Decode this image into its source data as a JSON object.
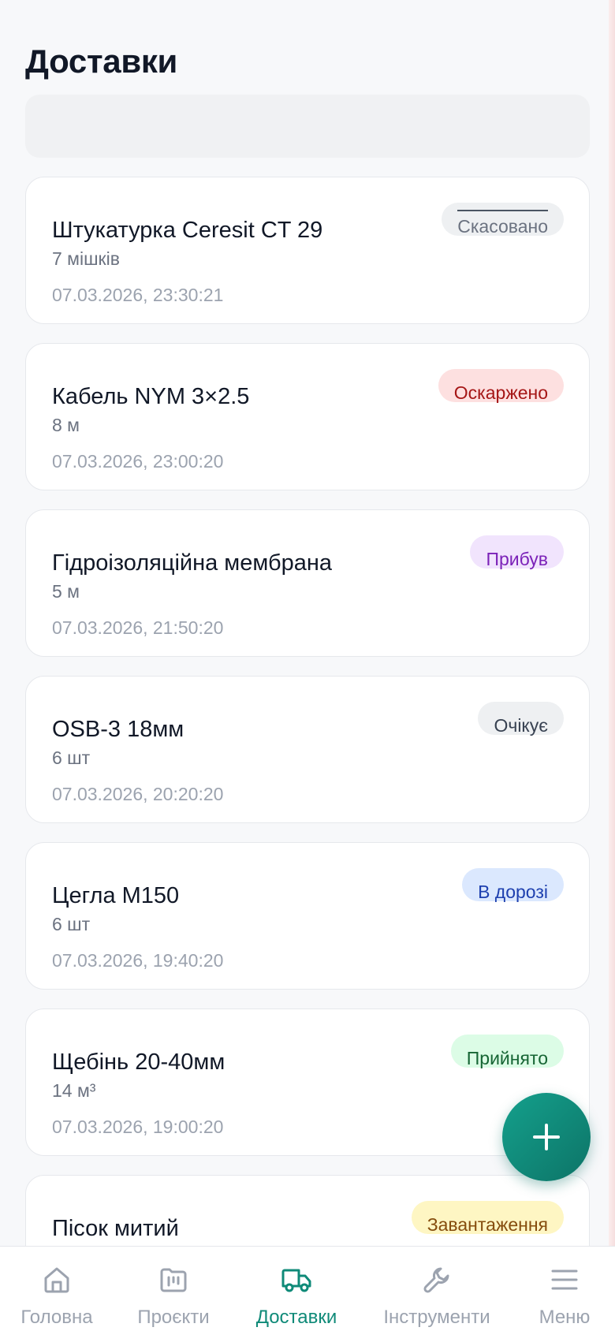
{
  "header": {
    "title": "Доставки"
  },
  "search": {
    "placeholder": ""
  },
  "deliveries": [
    {
      "name": "Штукатурка Ceresit CT 29",
      "quantity": "7 мішків",
      "datetime": "07.03.2026, 23:30:21",
      "status": "Скасовано",
      "status_kind": "cancelled"
    },
    {
      "name": "Кабель NYM 3×2.5",
      "quantity": "8 м",
      "datetime": "07.03.2026, 23:00:20",
      "status": "Оскаржено",
      "status_kind": "disputed"
    },
    {
      "name": "Гідроізоляційна мембрана",
      "quantity": "5 м",
      "datetime": "07.03.2026, 21:50:20",
      "status": "Прибув",
      "status_kind": "arrived"
    },
    {
      "name": "OSB-3 18мм",
      "quantity": "6 шт",
      "datetime": "07.03.2026, 20:20:20",
      "status": "Очікує",
      "status_kind": "waiting"
    },
    {
      "name": "Цегла М150",
      "quantity": "6 шт",
      "datetime": "07.03.2026, 19:40:20",
      "status": "В дорозі",
      "status_kind": "transit"
    },
    {
      "name": "Щебінь 20-40мм",
      "quantity": "14 м³",
      "datetime": "07.03.2026, 19:00:20",
      "status": "Прийнято",
      "status_kind": "accepted"
    },
    {
      "name": "Пісок митий",
      "quantity": "",
      "datetime": "",
      "status": "Завантаження",
      "status_kind": "loading"
    }
  ],
  "fab": {
    "icon": "plus-icon"
  },
  "tabbar": {
    "active": "deliveries",
    "items": [
      {
        "id": "home",
        "label": "Головна",
        "icon": "home-icon"
      },
      {
        "id": "projects",
        "label": "Проєкти",
        "icon": "projects-icon"
      },
      {
        "id": "deliveries",
        "label": "Доставки",
        "icon": "truck-icon"
      },
      {
        "id": "tools",
        "label": "Інструменти",
        "icon": "wrench-icon"
      },
      {
        "id": "menu",
        "label": "Меню",
        "icon": "menu-icon"
      }
    ]
  },
  "colors": {
    "accent": "#0f8a78",
    "background": "#f7f8fa",
    "inactive_tab": "#9ca3af"
  }
}
